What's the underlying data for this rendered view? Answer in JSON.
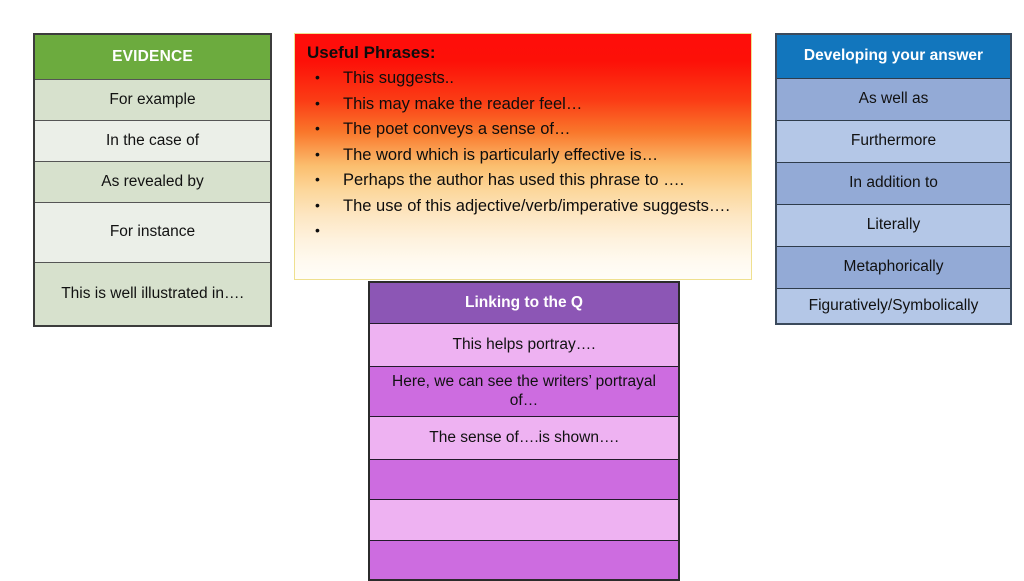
{
  "slide": {
    "background": "#ffffff",
    "kind": "teaching-slide-writing-prompts"
  },
  "evidence_mat": {
    "header": "EVIDENCE",
    "header_color": "#6cab3e",
    "row_color_a": "#d7e1cd",
    "row_color_b": "#ebefe8",
    "rows": [
      "For example",
      "In the case of",
      "As revealed by",
      "For instance",
      "This is well illustrated in…."
    ]
  },
  "useful_phrases": {
    "title": "Useful Phrases:",
    "gradient_top": "#fe0d0b",
    "gradient_bottom": "#fffdf8",
    "border_color": "#efe08f",
    "bullet_glyph": "•",
    "items": [
      "This suggests..",
      "This may make the reader feel…",
      "The poet conveys a sense of…",
      "The word which is particularly effective is…",
      "Perhaps the author has used this phrase to ….",
      "The use of this adjective/verb/imperative suggests….",
      ""
    ]
  },
  "developing_mat": {
    "header": "Developing your answer",
    "header_color": "#1276bd",
    "row_color_a": "#93aad6",
    "row_color_b": "#b4c7e7",
    "rows": [
      "As well as",
      "Furthermore",
      "In addition to",
      "Literally",
      "Metaphorically",
      "Figuratively/Symbolically"
    ]
  },
  "linking_mat": {
    "header": "Linking to the Q",
    "header_color": "#8c56b5",
    "row_color_a": "#cd6ce0",
    "row_color_b": "#eeb2f2",
    "rows": [
      "This helps portray….",
      "Here, we can see the writers’ portrayal of…",
      "The sense of….is shown….",
      "",
      "",
      ""
    ]
  }
}
